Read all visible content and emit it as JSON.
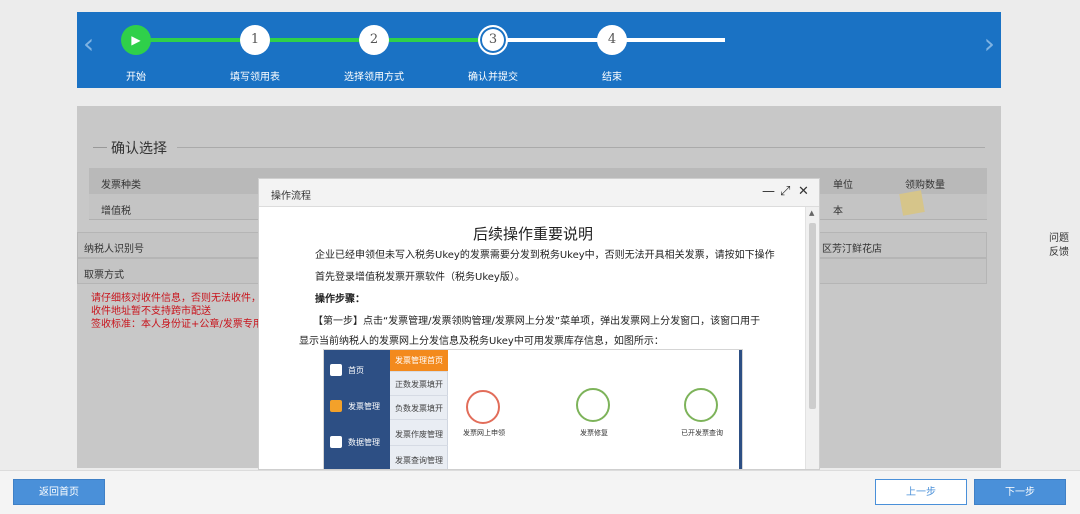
{
  "stepper": {
    "steps": [
      {
        "label": "开始",
        "number": ""
      },
      {
        "label": "填写领用表",
        "number": "1"
      },
      {
        "label": "选择领用方式",
        "number": "2"
      },
      {
        "label": "确认并提交",
        "number": "3"
      },
      {
        "label": "结束",
        "number": "4"
      }
    ],
    "prev_arrow": "‹",
    "next_arrow": "›",
    "start_icon": "▶"
  },
  "page": {
    "section_title": "确认选择",
    "table": {
      "headers": {
        "type": "发票种类",
        "unit": "单位",
        "qty": "领购数量"
      },
      "row": {
        "type": "增值税",
        "unit": "本"
      }
    },
    "taxpayer_label": "纳税人识别号",
    "taxpayer_value": "区芳汀鲜花店",
    "pickup_label": "取票方式",
    "notice_lines": [
      "请仔细核对收件信息，否则无法收件，",
      "收件地址暂不支持跨市配送",
      "签收标准：本人身份证+公章/发票专用"
    ]
  },
  "side": {
    "line1": "问题",
    "line2": "反馈"
  },
  "modal": {
    "title": "操作流程",
    "minimize": "—",
    "maximize": "⤢",
    "close": "✕",
    "doc_title": "后续操作重要说明",
    "p1": "企业已经申领但未写入税务Ukey的发票需要分发到税务Ukey中，否则无法开具相关发票，请按如下操作",
    "p2": "首先登录增值税发票开票软件（税务Ukey版）。",
    "p3": "操作步骤：",
    "p4": "【第一步】点击“发票管理/发票领购管理/发票网上分发”菜单项，弹出发票网上分发窗口，该窗口用于",
    "p5": "显示当前纳税人的发票网上分发信息及税务Ukey中可用发票库存信息，如图所示：",
    "embed": {
      "nav": [
        "首页",
        "发票管理",
        "数据管理"
      ],
      "sub": [
        "发票管理首页",
        "正数发票填开",
        "负数发票填开",
        "发票作废管理",
        "发票查询管理"
      ],
      "icons": [
        "发票网上申领",
        "发票修复",
        "已开发票查询"
      ]
    }
  },
  "buttons": {
    "home": "返回首页",
    "prev": "上一步",
    "next": "下一步"
  }
}
